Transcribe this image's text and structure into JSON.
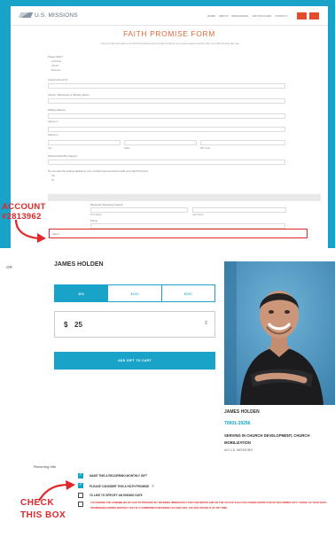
{
  "panel1": {
    "logo": "U.S. MISSIONS",
    "nav": [
      "HOME",
      "ABOUT",
      "RESOURCES",
      "GET INVOLVED",
      "CONTACT"
    ],
    "nav_buttons": [
      "",
      ""
    ],
    "title": "FAITH PROMISE FORM",
    "intro": "Use your faith and make a commitment believing that God will provide for you to give towards missions with your Faith Promise this year.",
    "fields": {
      "prayer_q": "Prayer Offer?",
      "prayer_opts": [
        "Individual",
        "Church",
        "Business"
      ],
      "church_acct": "Church Account #",
      "missionary_name": "Church / Missionary or Ministry Name",
      "mailing_address": "Mailing Address",
      "address1": "Address 1",
      "address2": "Address 2",
      "city": "City",
      "state": "State",
      "zip": "ZIP Code",
      "monthly_support": "Preferred Monthly Support",
      "schedule_q": "Do you want the change applied to your monthly payment amount with your Faith Promise?",
      "schedule_opts": [
        "Yes",
        "No"
      ],
      "project_acct": "Missionary Receiving Support",
      "first": "First",
      "last": "Last",
      "first_sub": "First Name",
      "last_sub": "Last Name",
      "phone": "Phone",
      "missionary_acct": "Missionary Account #",
      "missionary_acct_value": "Select"
    },
    "annotation": [
      "ACCOUNT",
      "#2813962"
    ]
  },
  "panel2": {
    "gr_label": "GR",
    "name": "JAMES HOLDEN",
    "amount_options": [
      "$50",
      "$100",
      "$250"
    ],
    "selected_amount_index": 0,
    "currency": "$",
    "amount_value": "25",
    "stepper_icon": "⇕",
    "add_button": "ADD GIFT TO CART",
    "missionary": {
      "name": "JAMES HOLDEN",
      "account": "70901-29296",
      "role": "SERVING IN CHURCH DEVELOPMENT, CHURCH MOBILIZATION",
      "org": "AG U.S. MISSIONS"
    }
  },
  "panel3": {
    "label": "Recurring Info",
    "options": [
      {
        "text": "MAKE THIS A RECURRING MONTHLY GIFT",
        "checked": true,
        "help": false
      },
      {
        "text": "PLEASE CONSIDER THIS A FAITH PROMISE",
        "checked": true,
        "help": true
      },
      {
        "text": "I'D LIKE TO SPECIFY AN ENDING DATE",
        "checked": false,
        "help": false
      }
    ],
    "help_icon": "?",
    "authorization": "I AUTHORIZE THE ASSEMBLIES OF GOD TO PROCESS MY OFFERING IMMEDIATELY FOR THIS MONTH AND ON THE 15TH OF EACH FOLLOWING MONTH FOR MY RECURRING GIFT. I KNOW, AS YOUR FAITH PROMISE/RECURRING MONTHLY GIFT IS A COMMITMENT BETWEEN YOU AND GOD, YOU MAY REVISE IT AT ANY TIME.",
    "annotation": [
      "CHECK",
      "THIS BOX"
    ]
  },
  "colors": {
    "accent": "#1aa3c9",
    "annotation": "#e0282a",
    "title": "#e06a3c"
  }
}
